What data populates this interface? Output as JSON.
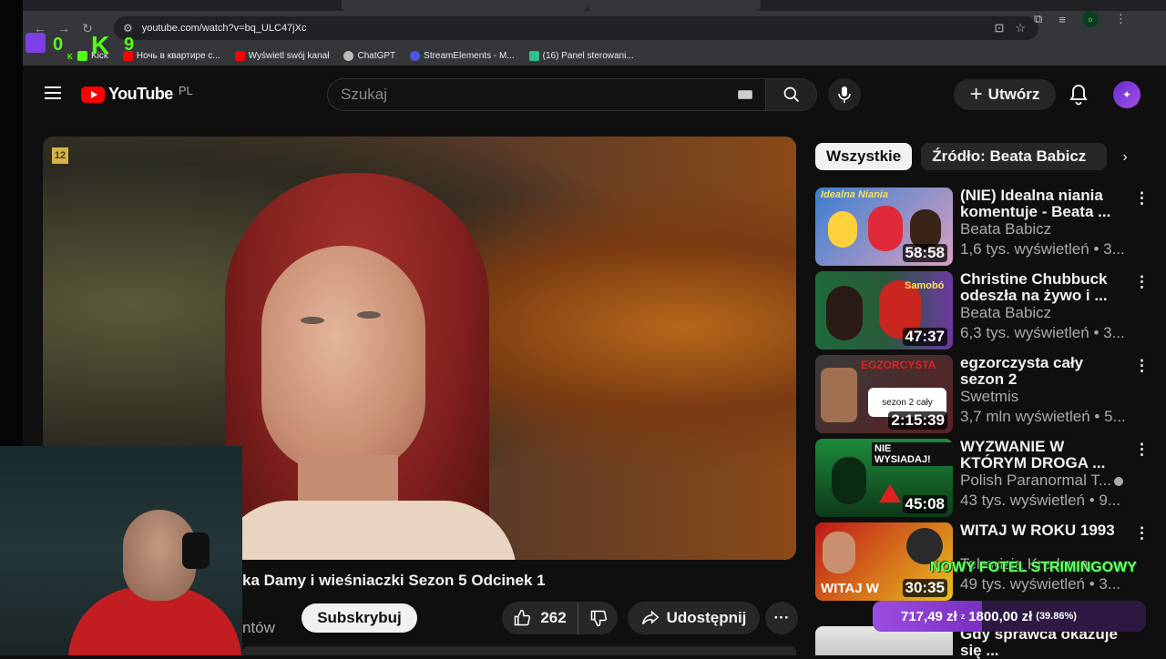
{
  "browser": {
    "url": "youtube.com/watch?v=bq_ULC47jXc",
    "bookmarks": [
      {
        "label": "Kick",
        "color": "#53fc18"
      },
      {
        "label": "Ночь в квартире с...",
        "color": "#ff0000"
      },
      {
        "label": "Wyświetl swój kanał",
        "color": "#ff0000"
      },
      {
        "label": "ChatGPT",
        "color": "#bbbbbb"
      },
      {
        "label": "StreamElements - M...",
        "color": "#4a5ae0"
      },
      {
        "label": "(16) Panel sterowani...",
        "color": "#2fbf8f"
      }
    ],
    "profile_initial": "o"
  },
  "stream_overlay": {
    "counter_left": "0",
    "counter_right": "9",
    "logo_letter": "K",
    "small_k": "K",
    "banner": "NOWY FOTEL STRIMINGOWY",
    "donation": {
      "current": "717,49 zł",
      "goal": "1800,00 zł",
      "percent": "(39.86%)",
      "fraction": 0.3986,
      "separator": "z"
    }
  },
  "header": {
    "logo_text": "YouTube",
    "country": "PL",
    "search_placeholder": "Szukaj",
    "create_label": "Utwórz"
  },
  "player": {
    "age_rating": "12"
  },
  "video": {
    "title": "ka Damy i wieśniaczki Sezon 5 Odcinek 1",
    "subscriber_fragment": "ntów",
    "subscribe_label": "Subskrybuj",
    "likes": "262",
    "share_label": "Udostępnij",
    "more_label": "···"
  },
  "chips": {
    "all": "Wszystkie",
    "source": "Źródło: Beata Babicz"
  },
  "recommended": [
    {
      "title": "(NIE) Idealna niania komentuje - Beata ...",
      "channel": "Beata Babicz",
      "meta": "1,6 tys. wyświetleń • 3...",
      "duration": "58:58",
      "thumb_text": "Idealna Niania",
      "colors": [
        "#3a7fd0",
        "#d8a0c0"
      ]
    },
    {
      "title": "Christine Chubbuck odeszła na żywo i ...",
      "channel": "Beata Babicz",
      "meta": "6,3 tys. wyświetleń • 3...",
      "duration": "47:37",
      "thumb_text": "Samobó",
      "colors": [
        "#1e6a3a",
        "#6a3aa0"
      ]
    },
    {
      "title": "egzorczysta cały sezon 2",
      "channel": "Swetmis",
      "meta": "3,7 mln wyświetleń • 5...",
      "duration": "2:15:39",
      "thumb_text": "sezon 2 cały",
      "thumb_title": "EGZORCYSTA",
      "colors": [
        "#b02020",
        "#3a3a3a"
      ]
    },
    {
      "title": "WYZWANIE W KTÓRYM DROGA ...",
      "channel": "Polish Paranormal T...",
      "meta": "43 tys. wyświetleń • 9...",
      "duration": "45:08",
      "thumb_text": "NIE WYSIADAJ!",
      "colors": [
        "#1c8a3a",
        "#0e3a1a"
      ]
    },
    {
      "title": "WITAJ W ROKU 1993",
      "channel": "Telewizja Kredowa",
      "meta": "49 tys. wyświetleń • 3...",
      "duration": "30:35",
      "thumb_text": "WITAJ W",
      "colors": [
        "#c01818",
        "#e8c020"
      ]
    },
    {
      "title": "Gdy sprawca okazuje się ...",
      "channel": "",
      "meta": "",
      "duration": "",
      "thumb_text": "",
      "colors": [
        "#e0e0e0",
        "#c0c0c0"
      ]
    }
  ]
}
